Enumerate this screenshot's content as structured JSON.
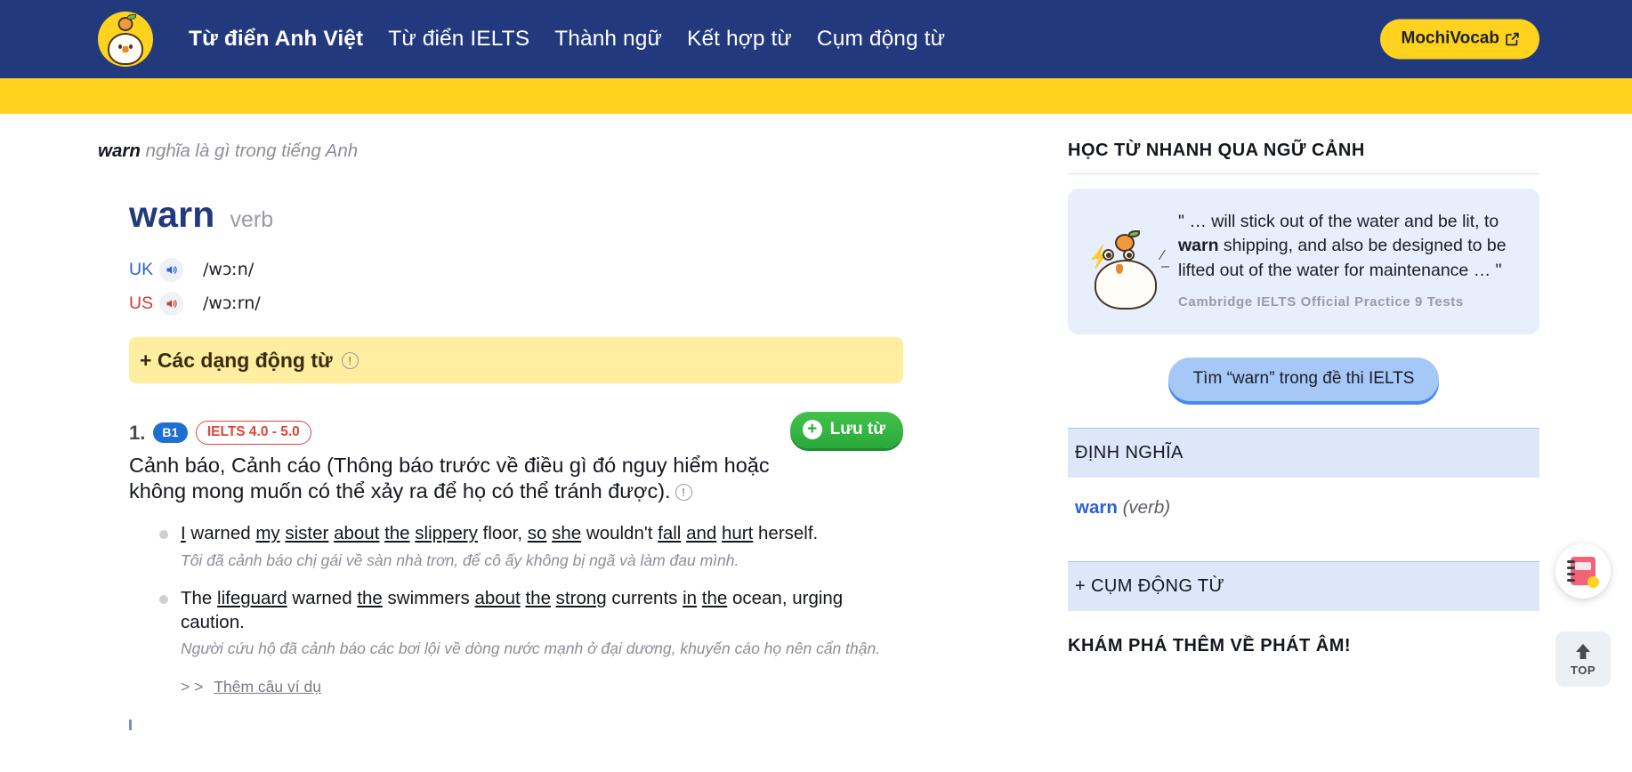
{
  "header": {
    "logo_icon": "mochi-chick-logo",
    "nav": [
      {
        "label": "Từ điển Anh Việt",
        "active": true
      },
      {
        "label": "Từ điển IELTS",
        "active": false
      },
      {
        "label": "Thành ngữ",
        "active": false
      },
      {
        "label": "Kết hợp từ",
        "active": false
      },
      {
        "label": "Cụm động từ",
        "active": false
      }
    ],
    "cta_label": "MochiVocab",
    "cta_icon": "external-link-icon",
    "accent_blue": "#23397e",
    "accent_yellow": "#ffd21e"
  },
  "breadcrumb": {
    "word": "warn",
    "rest": " nghĩa là gì trong tiếng Anh"
  },
  "entry": {
    "headword": "warn",
    "pos": "verb",
    "pronunciations": [
      {
        "region": "UK",
        "ipa": "/wɔːn/",
        "color": "#2b5fd9",
        "speaker_icon": "speaker-icon"
      },
      {
        "region": "US",
        "ipa": "/wɔːrn/",
        "color": "#d23a2e",
        "speaker_icon": "speaker-icon"
      }
    ],
    "verb_forms_label": "+ Các dạng động từ",
    "verb_forms_info_icon": "info-icon"
  },
  "sense": {
    "number": "1.",
    "cefr": "B1",
    "ielts": "IELTS 4.0 - 5.0",
    "save_label": "Lưu từ",
    "save_icon": "plus-circle-icon",
    "definition": "Cảnh báo, Cảnh cáo (Thông báo trước về điều gì đó nguy hiểm hoặc không mong muốn có thể xảy ra để họ có thể tránh được).",
    "definition_info_icon": "info-icon",
    "examples": [
      {
        "en_parts": [
          {
            "t": "I",
            "u": true
          },
          {
            "t": " warned ",
            "u": false
          },
          {
            "t": "my",
            "u": true
          },
          {
            "t": " ",
            "u": false
          },
          {
            "t": "sister",
            "u": true
          },
          {
            "t": " ",
            "u": false
          },
          {
            "t": "about",
            "u": true
          },
          {
            "t": " ",
            "u": false
          },
          {
            "t": "the",
            "u": true
          },
          {
            "t": " ",
            "u": false
          },
          {
            "t": "slippery",
            "u": true
          },
          {
            "t": " floor, ",
            "u": false
          },
          {
            "t": "so",
            "u": true
          },
          {
            "t": " ",
            "u": false
          },
          {
            "t": "she",
            "u": true
          },
          {
            "t": " wouldn't ",
            "u": false
          },
          {
            "t": "fall",
            "u": true
          },
          {
            "t": " ",
            "u": false
          },
          {
            "t": "and",
            "u": true
          },
          {
            "t": " ",
            "u": false
          },
          {
            "t": "hurt",
            "u": true
          },
          {
            "t": " herself.",
            "u": false
          }
        ],
        "vi": "Tôi đã cảnh báo chị gái về sàn nhà trơn, để cô ấy không bị ngã và làm đau mình."
      },
      {
        "en_parts": [
          {
            "t": "The ",
            "u": false
          },
          {
            "t": "lifeguard",
            "u": true
          },
          {
            "t": " warned ",
            "u": false
          },
          {
            "t": "the",
            "u": true
          },
          {
            "t": " swimmers ",
            "u": false
          },
          {
            "t": "about",
            "u": true
          },
          {
            "t": " ",
            "u": false
          },
          {
            "t": "the",
            "u": true
          },
          {
            "t": " ",
            "u": false
          },
          {
            "t": "strong",
            "u": true
          },
          {
            "t": " currents ",
            "u": false
          },
          {
            "t": "in",
            "u": true
          },
          {
            "t": " ",
            "u": false
          },
          {
            "t": "the",
            "u": true
          },
          {
            "t": " ocean, urging caution.",
            "u": false
          }
        ],
        "vi": "Người cứu hộ đã cảnh báo các bơi lội về dòng nước mạnh ở đại dương, khuyến cáo họ nên cẩn thận."
      }
    ],
    "more_examples_prefix": "> >",
    "more_examples_label": "Thêm câu ví dụ"
  },
  "sidebar": {
    "context_title": "HỌC TỪ NHANH QUA NGỮ CẢNH",
    "context_card": {
      "mascot_icon": "mochi-chick-mascot",
      "quote_before": "\" … will stick out of the water and be lit, to ",
      "quote_bold": "warn",
      "quote_after": " shipping, and also be designed to be lifted out of the water for maintenance … \"",
      "source": "Cambridge IELTS Official Practice 9 Tests",
      "button_label": "Tìm “warn” trong đề thi IELTS"
    },
    "definition_section": {
      "header": "ĐỊNH NGHĨA",
      "word": "warn",
      "pos": "(verb)"
    },
    "phrasal_section": {
      "header": "+ CỤM ĐỘNG TỪ",
      "plus_icon": "plus-icon"
    },
    "pronunciation_more_title": "KHÁM PHÁ THÊM VỀ PHÁT ÂM!"
  },
  "floating": {
    "flashcard_icon": "flashcard-icon",
    "top_label": "TOP",
    "top_icon": "arrow-up-icon"
  }
}
